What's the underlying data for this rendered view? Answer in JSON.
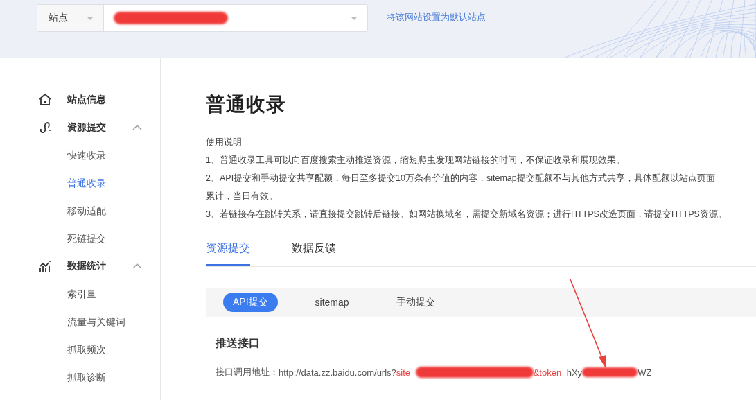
{
  "site_selector": {
    "type_label": "站点",
    "set_default_link": "将该网站设置为默认站点"
  },
  "sidebar": {
    "sections": [
      {
        "kind": "home",
        "label": "站点信息"
      },
      {
        "kind": "submit",
        "label": "资源提交",
        "expanded": true,
        "children": [
          {
            "label": "快速收录",
            "selected": false
          },
          {
            "label": "普通收录",
            "selected": true
          },
          {
            "label": "移动适配",
            "selected": false
          },
          {
            "label": "死链提交",
            "selected": false
          }
        ]
      },
      {
        "kind": "chart",
        "label": "数据统计",
        "expanded": true,
        "children": [
          {
            "label": "索引量",
            "selected": false
          },
          {
            "label": "流量与关键词",
            "selected": false
          },
          {
            "label": "抓取频次",
            "selected": false
          },
          {
            "label": "抓取诊断",
            "selected": false
          }
        ]
      }
    ]
  },
  "page": {
    "title": "普通收录",
    "notes_title": "使用说明",
    "notes": [
      "1、普通收录工具可以向百度搜索主动推送资源，缩短爬虫发现网站链接的时间，不保证收录和展现效果。",
      "2、API提交和手动提交共享配额，每日至多提交10万条有价值的内容，sitemap提交配额不与其他方式共享，具体配额以站点页面",
      "累计，当日有效。",
      "3、若链接存在跳转关系，请直接提交跳转后链接。如网站换域名，需提交新域名资源；进行HTTPS改造页面，请提交HTTPS资源。"
    ],
    "tabs": [
      {
        "label": "资源提交",
        "selected": true
      },
      {
        "label": "数据反馈",
        "selected": false
      }
    ],
    "methods": [
      {
        "label": "API提交",
        "selected": true
      },
      {
        "label": "sitemap",
        "selected": false
      },
      {
        "label": "手动提交",
        "selected": false
      }
    ],
    "section_title": "推送接口",
    "endpoint": {
      "label": "接口调用地址：",
      "base": "http://data.zz.baidu.com/urls?",
      "site_key": "site",
      "site_start": "=",
      "token_key": "&token",
      "token_start": "=hXy",
      "token_end": "WZ"
    }
  }
}
